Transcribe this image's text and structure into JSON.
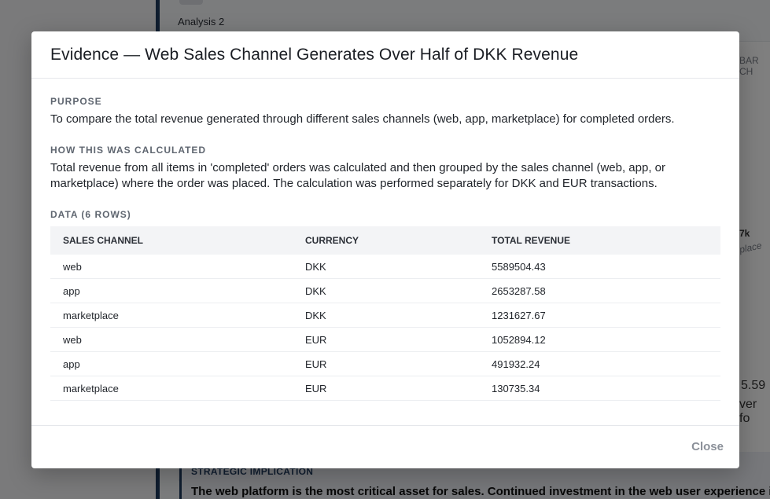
{
  "background": {
    "analysis_label": "Analysis 2",
    "peek_right_top": "BAR CH",
    "peek_chart_value": "7k",
    "peek_chart_label": "place",
    "peek_big_value": "5.59",
    "peek_big_sub": "ver fo",
    "strategic": {
      "heading": "STRATEGIC IMPLICATION",
      "text": "The web platform is the most critical asset for sales. Continued investment in the web user experience is"
    }
  },
  "modal": {
    "title": "Evidence — Web Sales Channel Generates Over Half of DKK Revenue",
    "purpose": {
      "label": "PURPOSE",
      "text": "To compare the total revenue generated through different sales channels (web, app, marketplace) for completed orders."
    },
    "method": {
      "label": "HOW THIS WAS CALCULATED",
      "text": "Total revenue from all items in 'completed' orders was calculated and then grouped by the sales channel (web, app, or marketplace) where the order was placed. The calculation was performed separately for DKK and EUR transactions."
    },
    "data": {
      "label": "DATA (6 rows)",
      "columns": [
        "SALES CHANNEL",
        "CURRENCY",
        "TOTAL REVENUE"
      ],
      "rows": [
        [
          "web",
          "DKK",
          "5589504.43"
        ],
        [
          "app",
          "DKK",
          "2653287.58"
        ],
        [
          "marketplace",
          "DKK",
          "1231627.67"
        ],
        [
          "web",
          "EUR",
          "1052894.12"
        ],
        [
          "app",
          "EUR",
          "491932.24"
        ],
        [
          "marketplace",
          "EUR",
          "130735.34"
        ]
      ]
    },
    "close_label": "Close"
  }
}
